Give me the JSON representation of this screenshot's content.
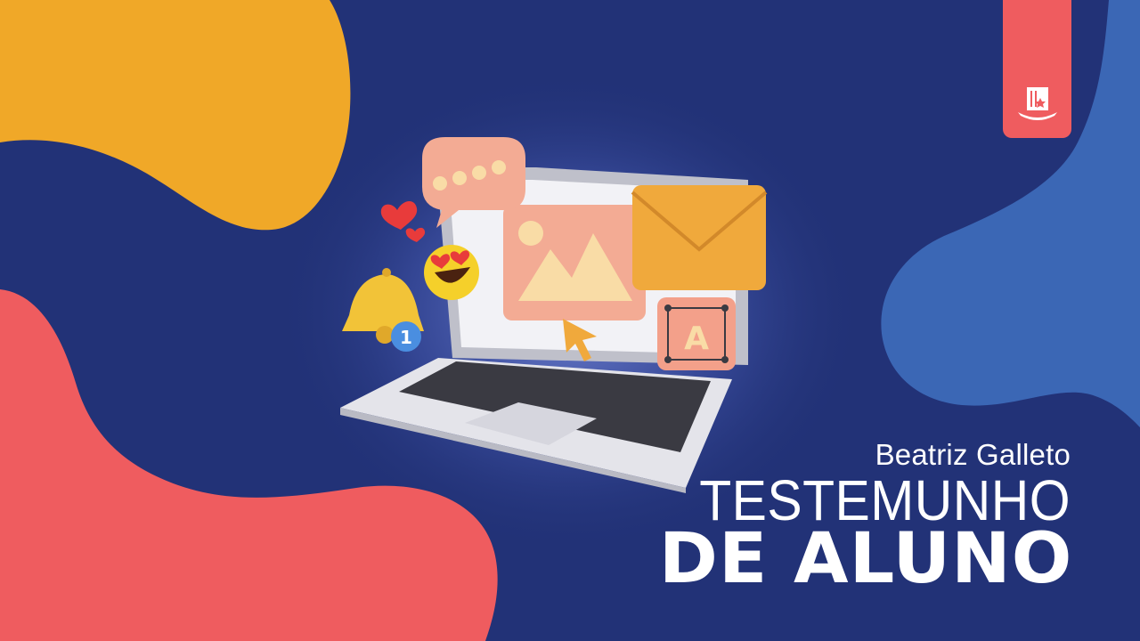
{
  "author": "Beatriz Galleto",
  "title_line1": "TESTEMUNHO",
  "title_line2": "DE ALUNO",
  "badge_icon": "top-hat-logo-icon",
  "notification_count": "1",
  "text_tile_letter": "A",
  "colors": {
    "background": "#223277",
    "yellow_blob": "#f0a828",
    "red_blob": "#ef5c5f",
    "blue_blob": "#3b67b5",
    "badge": "#ef5c5f",
    "text": "#ffffff"
  }
}
